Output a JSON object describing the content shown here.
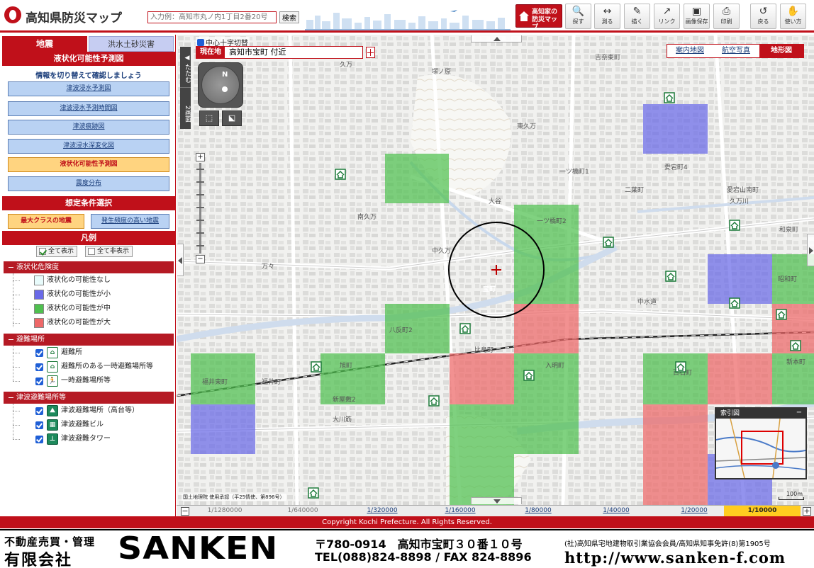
{
  "header": {
    "title": "高知県防災マップ",
    "search_placeholder": "入力例：高知市丸ノ内1丁目2番20号",
    "search_button": "検索",
    "home_map": "高知家の防災マップ",
    "tools": [
      {
        "name": "search-tool",
        "glyph": "🔍",
        "label": "探す"
      },
      {
        "name": "measure-tool",
        "glyph": "↔",
        "label": "測る"
      },
      {
        "name": "draw-tool",
        "glyph": "✎",
        "label": "描く"
      },
      {
        "name": "link-tool",
        "glyph": "↗",
        "label": "リンク"
      },
      {
        "name": "save-image-tool",
        "glyph": "▣",
        "label": "画像保存"
      },
      {
        "name": "print-tool",
        "glyph": "⎙",
        "label": "印刷"
      },
      {
        "name": "back-tool",
        "glyph": "↺",
        "label": "戻る"
      },
      {
        "name": "help-tool",
        "glyph": "✋",
        "label": "使い方"
      }
    ]
  },
  "sidebar": {
    "tabs": {
      "earthquake": "地震",
      "flood": "洪水土砂災害"
    },
    "section_title": "液状化可能性予測図",
    "info": "情報を切り替えて確認しましょう",
    "map_buttons": [
      {
        "label": "津波浸水予測図",
        "active": false
      },
      {
        "label": "津波浸水予測時間図",
        "active": false
      },
      {
        "label": "津波痕跡図",
        "active": false
      },
      {
        "label": "津波浸水深変化図",
        "active": false
      },
      {
        "label": "液状化可能性予測図",
        "active": true
      },
      {
        "label": "震度分布",
        "active": false
      }
    ],
    "conditions_title": "想定条件選択",
    "conditions": {
      "max_class": "最大クラスの地震",
      "frequent": "発生頻度の高い地震"
    },
    "legend_title": "凡例",
    "show_all": "全て表示",
    "hide_all": "全て非表示",
    "liquefaction": {
      "title": "液状化危険度",
      "items": [
        {
          "label": "液状化の可能性なし",
          "color": "#e8fbfb"
        },
        {
          "label": "液状化の可能性が小",
          "color": "#6a6ae8"
        },
        {
          "label": "液状化の可能性が中",
          "color": "#4fc04f"
        },
        {
          "label": "液状化の可能性が大",
          "color": "#ee6868"
        }
      ]
    },
    "shelters": {
      "title": "避難場所",
      "items": [
        {
          "label": "避難所",
          "icon": "shelter-icon"
        },
        {
          "label": "避難所のある一時避難場所等",
          "icon": "shelter-temporary-icon"
        },
        {
          "label": "一時避難場所等",
          "icon": "temporary-evacuation-icon"
        }
      ]
    },
    "tsunami": {
      "title": "津波避難場所等",
      "items": [
        {
          "label": "津波避難場所（高台等）",
          "icon": "tsunami-highground-icon"
        },
        {
          "label": "津波避難ビル",
          "icon": "tsunami-building-icon"
        },
        {
          "label": "津波避難タワー",
          "icon": "tsunami-tower-icon"
        }
      ]
    }
  },
  "map": {
    "crosshair_toggle": "中心十字切替",
    "collapse": "たたむ",
    "split": "2画面",
    "location_label": "現在地",
    "location_value": "高知市宝町 付近",
    "map_types": [
      {
        "label": "案内地図",
        "active": false
      },
      {
        "label": "航空写真",
        "active": false
      },
      {
        "label": "地形図",
        "active": true
      }
    ],
    "compass": "N",
    "index_map_title": "索引図",
    "attribution": "国土地理院 使用承認（平25情使、第896号）",
    "scale_bar": "100m",
    "place_labels": [
      "久万",
      "吉奈東町",
      "塚ノ原",
      "東久万",
      "一ツ橋町1",
      "愛宕町4",
      "二葉町",
      "愛宕山南町",
      "久万川",
      "大谷",
      "南久万",
      "一ツ橋町2",
      "和泉町",
      "中久万",
      "万々",
      "宝町",
      "昭和町",
      "中水道",
      "八反町2",
      "比島町",
      "新本町",
      "福井東町",
      "福井町",
      "旭町",
      "新屋敷2",
      "大川筋",
      "入明町",
      "百石町"
    ],
    "scales": [
      {
        "label": "1/1280000",
        "state": "dim"
      },
      {
        "label": "1/640000",
        "state": "dim"
      },
      {
        "label": "1/320000",
        "state": "link"
      },
      {
        "label": "1/160000",
        "state": "link"
      },
      {
        "label": "1/80000",
        "state": "link"
      },
      {
        "label": "1/40000",
        "state": "link"
      },
      {
        "label": "1/20000",
        "state": "link"
      },
      {
        "label": "1/10000",
        "state": "active"
      }
    ]
  },
  "copyright": "Copyright Kochi Prefecture. All Rights Reserved.",
  "footer": {
    "line1": "不動産売買・管理",
    "line2": "有限会社",
    "brand": "SANKEN",
    "address": "〒780-0914　高知市宝町３０番１０号",
    "tel": "TEL(088)824-8898 / FAX 824-8896",
    "license": "(社)高知県宅地建物取引業協会会員/高知県知事免許(8)第1905号",
    "url": "http://www.sanken-f.com"
  }
}
